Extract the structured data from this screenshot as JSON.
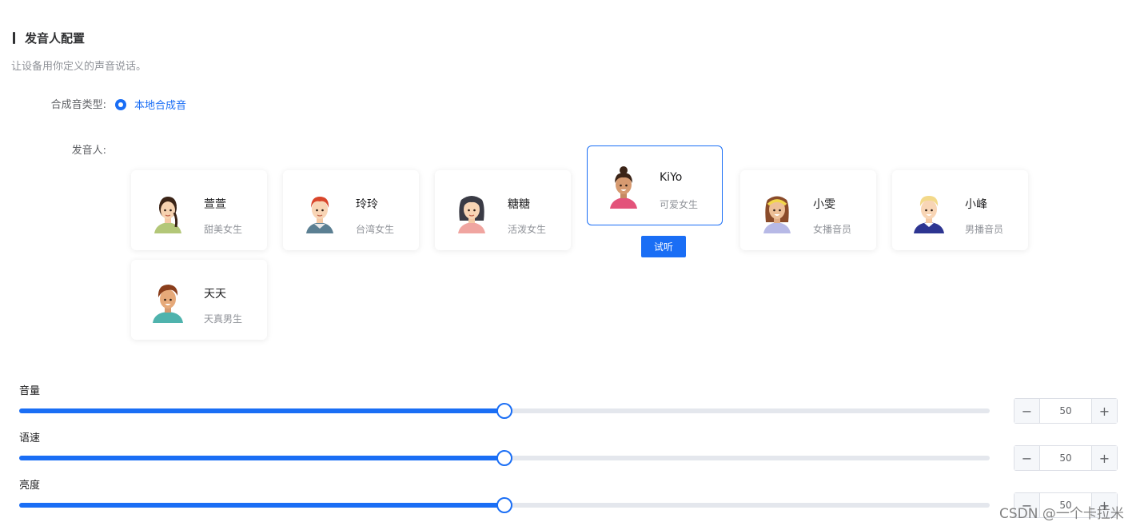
{
  "header": {
    "title": "发音人配置",
    "subtitle": "让设备用你定义的声音说话。"
  },
  "form": {
    "synth_type_label": "合成音类型:",
    "synth_type_option": "本地合成音",
    "speaker_label": "发音人:"
  },
  "speakers": [
    {
      "name": "萱萱",
      "desc": "甜美女生",
      "avatar": "girl-braid-avatar"
    },
    {
      "name": "玲玲",
      "desc": "台湾女生",
      "avatar": "girl-red-hair-avatar"
    },
    {
      "name": "糖糖",
      "desc": "活泼女生",
      "avatar": "girl-long-black-hair-avatar"
    },
    {
      "name": "KiYo",
      "desc": "可爱女生",
      "avatar": "girl-bun-avatar"
    },
    {
      "name": "小雯",
      "desc": "女播音员",
      "avatar": "girl-headband-avatar"
    },
    {
      "name": "小峰",
      "desc": "男播音员",
      "avatar": "boy-blonde-avatar"
    },
    {
      "name": "天天",
      "desc": "天真男生",
      "avatar": "boy-brown-hair-avatar"
    }
  ],
  "selected_speaker": "KiYo",
  "listen_button": "试听",
  "sliders": [
    {
      "label": "音量",
      "value": 50,
      "min": 0,
      "max": 100
    },
    {
      "label": "语速",
      "value": 50,
      "min": 0,
      "max": 100
    },
    {
      "label": "亮度",
      "value": 50,
      "min": 0,
      "max": 100
    }
  ],
  "stepper_minus": "−",
  "stepper_plus": "+",
  "watermark": "CSDN @一个卡拉米",
  "colors": {
    "accent": "#1a6ef5",
    "track": "#e4e7ed",
    "text": "#303133",
    "muted": "#909399"
  }
}
